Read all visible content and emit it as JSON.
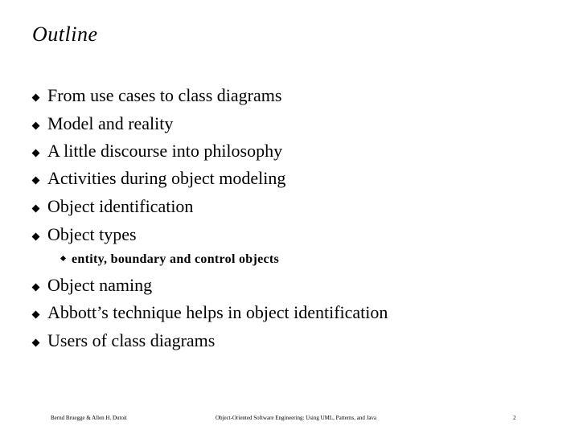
{
  "slide": {
    "title": "Outline",
    "bullets": [
      {
        "label": "From use cases to class diagrams"
      },
      {
        "label": "Model and reality"
      },
      {
        "label": "A little discourse into philosophy"
      },
      {
        "label": "Activities during object modeling"
      },
      {
        "label": "Object identification"
      },
      {
        "label": "Object types",
        "sub_bullets": [
          {
            "label": "entity, boundary and control objects"
          }
        ]
      },
      {
        "label": "Object naming"
      },
      {
        "label": "Abbott’s technique helps in object identification"
      },
      {
        "label": "Users of class diagrams"
      }
    ],
    "footer": {
      "authors": "Bernd Bruegge & Allen H. Dutoit",
      "book_title": "Object-Oriented Software Engineering: Using UML, Patterns, and Java",
      "page_number": "2"
    },
    "icons": {
      "bullet": "diamond-bullet-icon",
      "sub_bullet": "diamond-bullet-icon"
    }
  }
}
